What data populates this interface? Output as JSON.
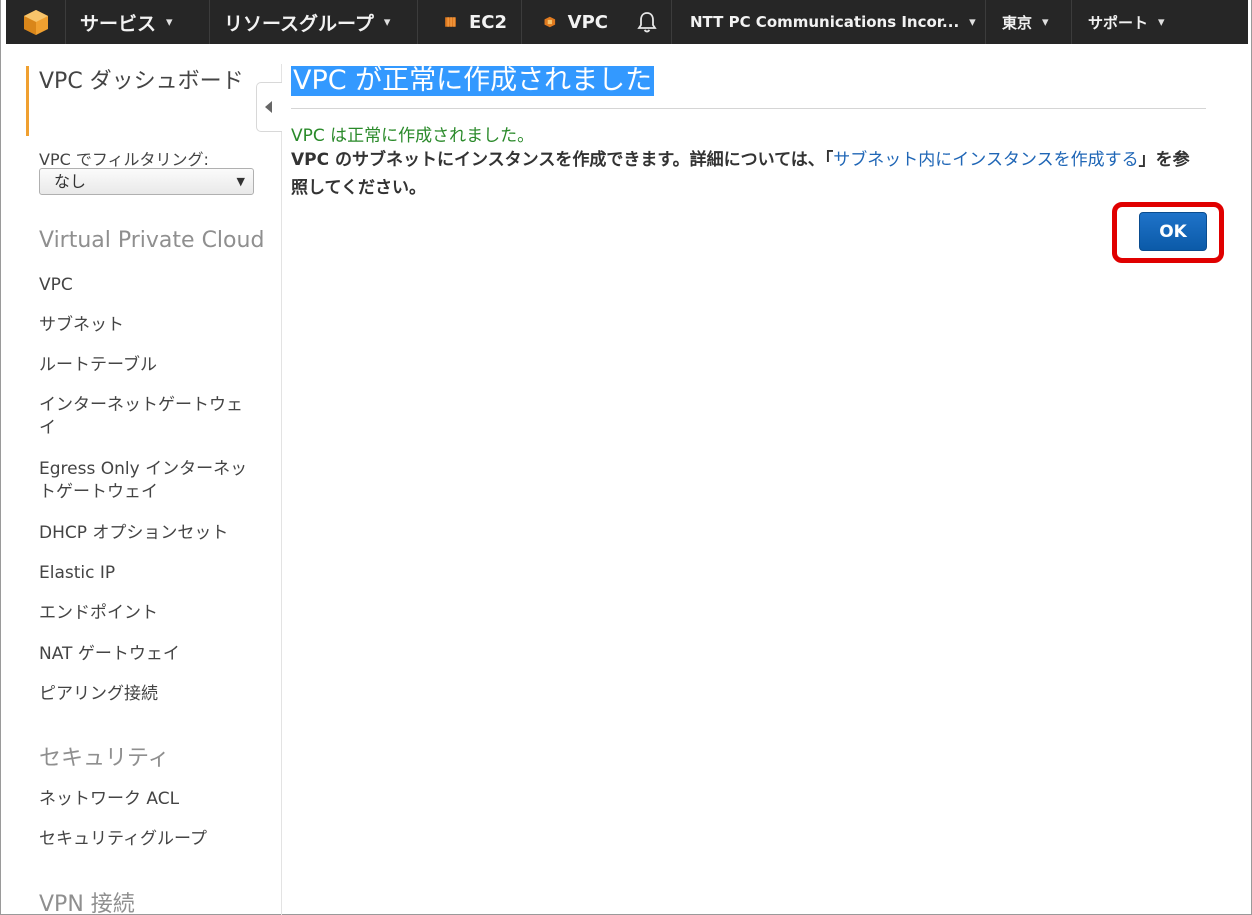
{
  "topbar": {
    "services": "サービス",
    "resource_groups": "リソースグループ",
    "ec2": "EC2",
    "vpc": "VPC",
    "account": "NTT PC Communications Incor...",
    "region": "東京",
    "support": "サポート"
  },
  "sidebar": {
    "dashboard": "VPC ダッシュボード",
    "filter_label": "VPC でフィルタリング:",
    "filter_value": "なし",
    "section_vpc": "Virtual Private Cloud",
    "items_vpc": [
      "VPC",
      "サブネット",
      "ルートテーブル",
      "インターネットゲートウェイ",
      "Egress Only インターネットゲートウェイ",
      "DHCP オプションセット",
      "Elastic IP",
      "エンドポイント",
      "NAT ゲートウェイ",
      "ピアリング接続"
    ],
    "section_security": "セキュリティ",
    "items_security": [
      "ネットワーク ACL",
      "セキュリティグループ"
    ],
    "section_vpn": "VPN 接続"
  },
  "main": {
    "title": "VPC が正常に作成されました",
    "success": "VPC は正常に作成されました。",
    "info_prefix": "VPC のサブネットにインスタンスを作成できます。詳細については、「",
    "info_link": "サブネット内にインスタンスを作成する",
    "info_suffix": "」を参照してください。",
    "ok_label": "OK"
  },
  "colors": {
    "accent": "#f0a030",
    "title_highlight": "#3399ff",
    "success": "#2a8a2a",
    "link": "#1f66b6",
    "button": "#1f73c9",
    "annotation": "#e00000"
  }
}
